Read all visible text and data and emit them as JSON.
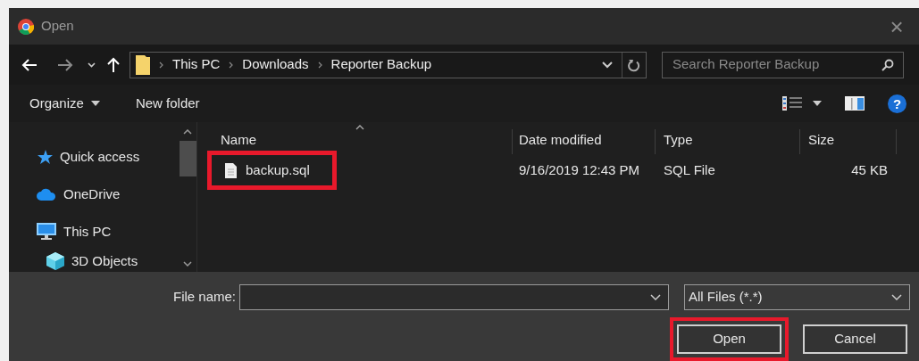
{
  "window": {
    "title": "Open",
    "close": "×"
  },
  "address": {
    "crumbs": [
      "This PC",
      "Downloads",
      "Reporter Backup"
    ],
    "search_placeholder": "Search Reporter Backup"
  },
  "toolbar": {
    "organize": "Organize",
    "new_folder": "New folder",
    "help": "?"
  },
  "sidebar": {
    "items": [
      {
        "label": "Quick access",
        "kind": "star",
        "indent": false
      },
      {
        "label": "OneDrive",
        "kind": "cloud",
        "indent": false
      },
      {
        "label": "This PC",
        "kind": "pc",
        "indent": false
      },
      {
        "label": "3D Objects",
        "kind": "cube",
        "indent": true
      }
    ]
  },
  "table": {
    "columns": [
      "Name",
      "Date modified",
      "Type",
      "Size"
    ],
    "rows": [
      {
        "name": "backup.sql",
        "date": "9/16/2019 12:43 PM",
        "type": "SQL File",
        "size": "45 KB",
        "highlighted": true
      }
    ]
  },
  "footer": {
    "file_name_label": "File name:",
    "filter": "All Files (*.*)",
    "buttons": [
      {
        "label": "Open",
        "highlighted": true
      },
      {
        "label": "Cancel",
        "highlighted": false
      }
    ]
  }
}
